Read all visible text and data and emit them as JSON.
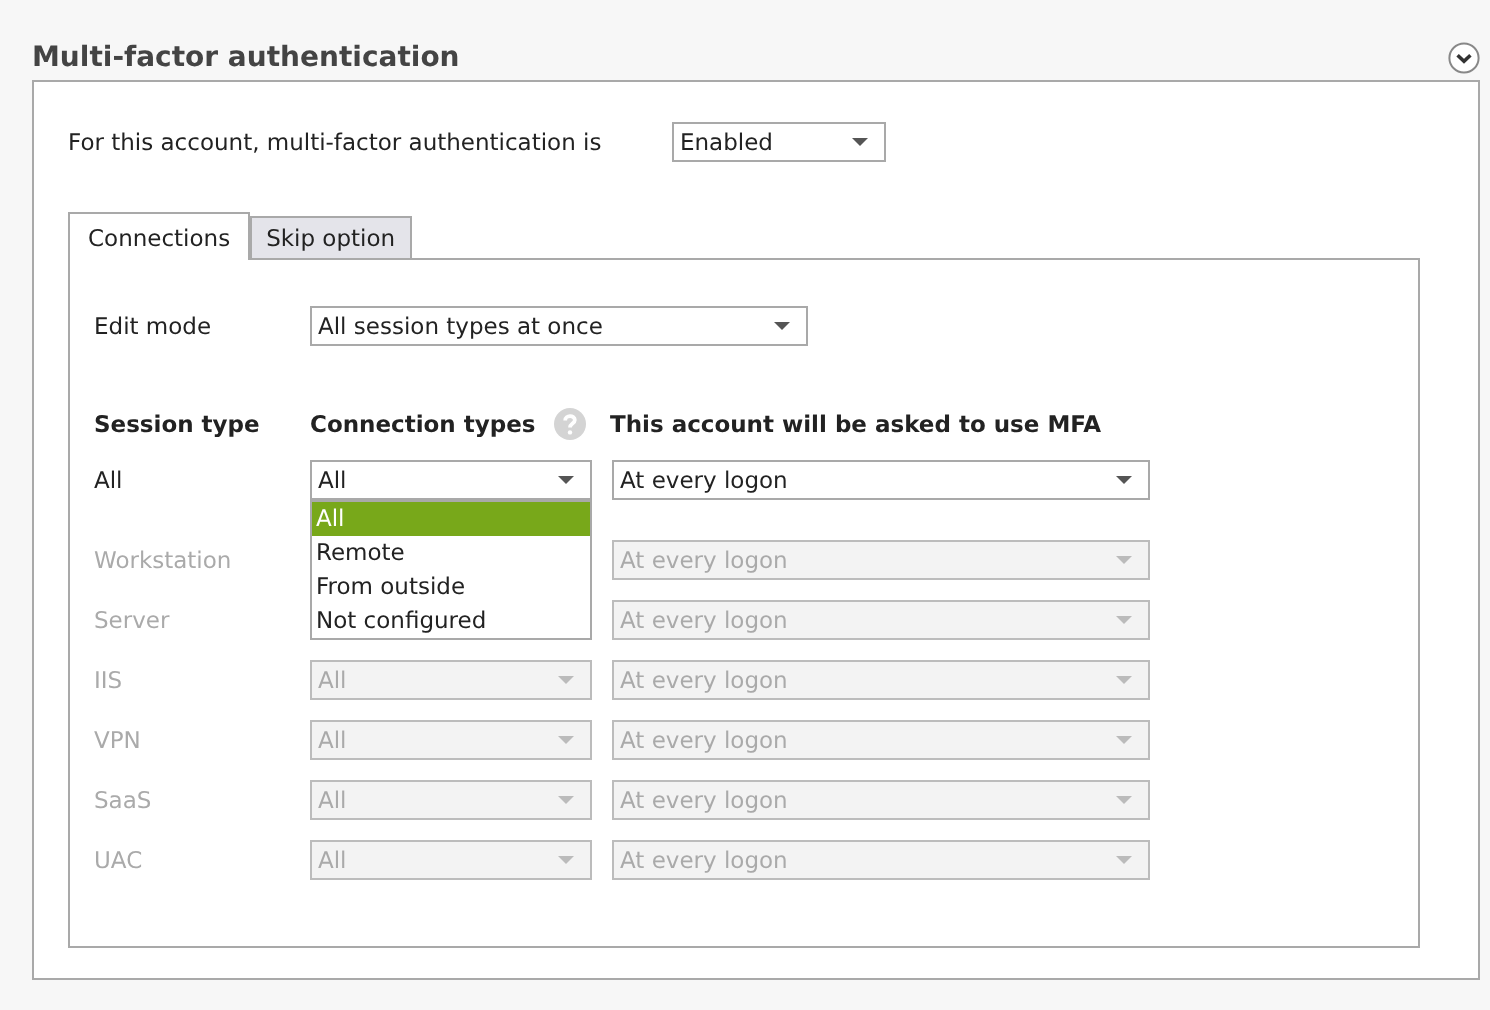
{
  "section": {
    "title": "Multi-factor authentication",
    "expanded": true
  },
  "status": {
    "label": "For this account, multi-factor authentication is",
    "value": "Enabled"
  },
  "tabs": [
    {
      "label": "Connections",
      "selected": true
    },
    {
      "label": "Skip option",
      "selected": false
    }
  ],
  "edit_mode": {
    "label": "Edit mode",
    "value": "All session types at once"
  },
  "table": {
    "columns": [
      "Session type",
      "Connection types",
      "This account will be asked to use MFA"
    ],
    "rows": [
      {
        "session_type": "All",
        "connection_types": "All",
        "mfa": "At every logon",
        "disabled": false
      },
      {
        "session_type": "Workstation",
        "mfa": "At every logon",
        "disabled": true
      },
      {
        "session_type": "Server",
        "mfa": "At every logon",
        "disabled": true
      },
      {
        "session_type": "IIS",
        "connection_types": "All",
        "mfa": "At every logon",
        "disabled": true
      },
      {
        "session_type": "VPN",
        "connection_types": "All",
        "mfa": "At every logon",
        "disabled": true
      },
      {
        "session_type": "SaaS",
        "connection_types": "All",
        "mfa": "At every logon",
        "disabled": true
      },
      {
        "session_type": "UAC",
        "connection_types": "All",
        "mfa": "At every logon",
        "disabled": true
      }
    ]
  },
  "dropdown": {
    "options": [
      {
        "label": "All",
        "selected": true
      },
      {
        "label": "Remote",
        "selected": false
      },
      {
        "label": "From outside",
        "selected": false
      },
      {
        "label": "Not configured",
        "selected": false
      }
    ]
  }
}
